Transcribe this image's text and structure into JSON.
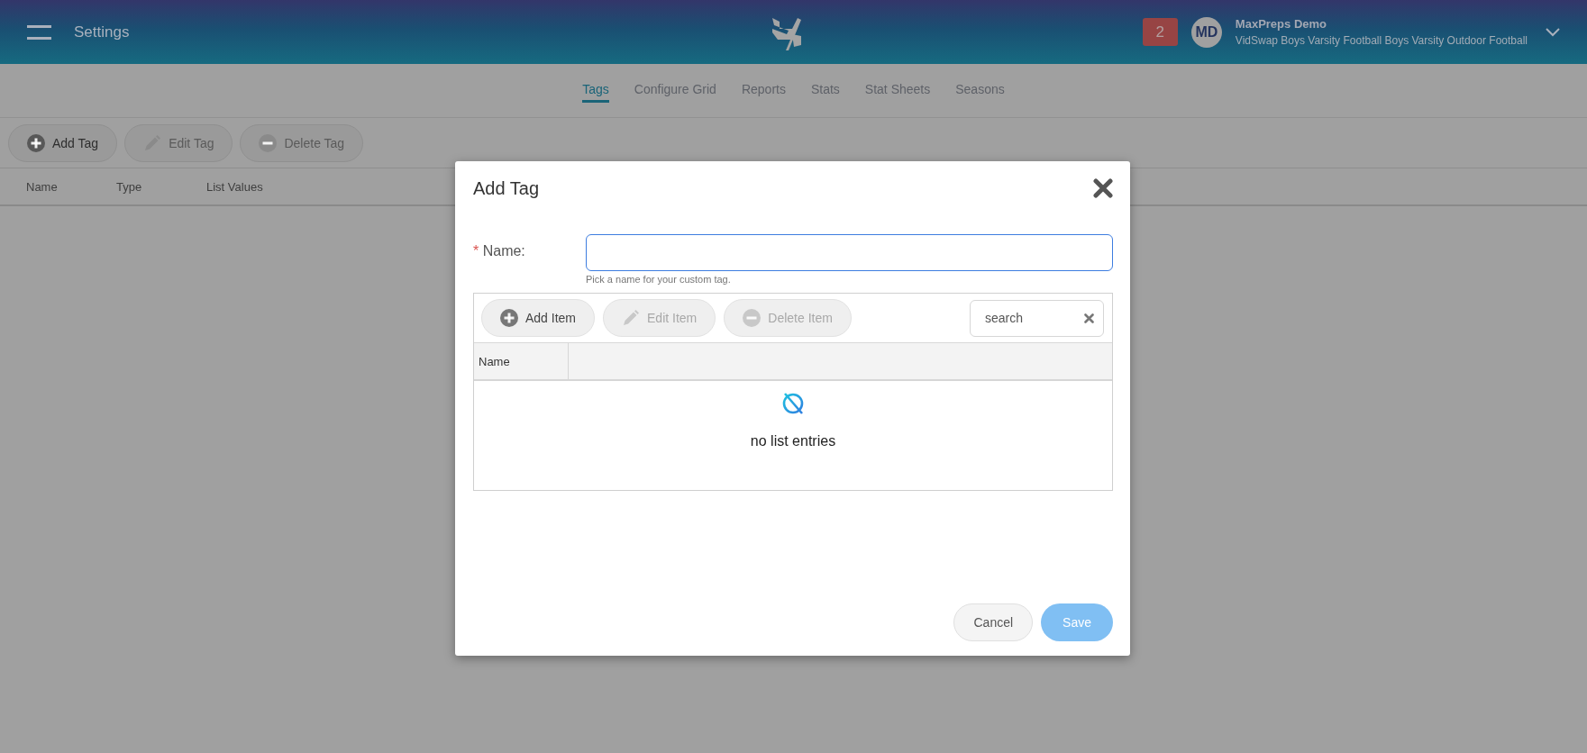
{
  "header": {
    "title": "Settings",
    "notification_count": "2",
    "avatar_initials": "MD",
    "user_name": "MaxPreps Demo",
    "team": "VidSwap Boys Varsity Football Boys Varsity Outdoor Football"
  },
  "tabs": [
    {
      "label": "Tags",
      "selected": true
    },
    {
      "label": "Configure Grid",
      "selected": false
    },
    {
      "label": "Reports",
      "selected": false
    },
    {
      "label": "Stats",
      "selected": false
    },
    {
      "label": "Stat Sheets",
      "selected": false
    },
    {
      "label": "Seasons",
      "selected": false
    }
  ],
  "toolbar": [
    {
      "label": "Add Tag",
      "kind": "add",
      "disabled": false
    },
    {
      "label": "Edit Tag",
      "kind": "edit",
      "disabled": true
    },
    {
      "label": "Delete Tag",
      "kind": "delete",
      "disabled": true
    }
  ],
  "table": {
    "columns": [
      "Name",
      "Type",
      "List Values"
    ]
  },
  "dialog": {
    "title": "Add Tag",
    "name_field": {
      "label": "Name:",
      "required": true,
      "required_mark": "*",
      "hint": "Pick a name for your custom tag."
    },
    "list_toolbar": [
      {
        "label": "Add Item",
        "kind": "add",
        "disabled": false
      },
      {
        "label": "Edit Item",
        "kind": "edit",
        "disabled": true
      },
      {
        "label": "Delete Item",
        "kind": "delete",
        "disabled": true
      }
    ],
    "search": {
      "placeholder": "search"
    },
    "list_columns": [
      "Name"
    ],
    "empty_message": "no list entries",
    "buttons": [
      {
        "label": "Cancel",
        "kind": "secondary",
        "disabled": false
      },
      {
        "label": "Save",
        "kind": "primary",
        "disabled": true
      }
    ]
  }
}
